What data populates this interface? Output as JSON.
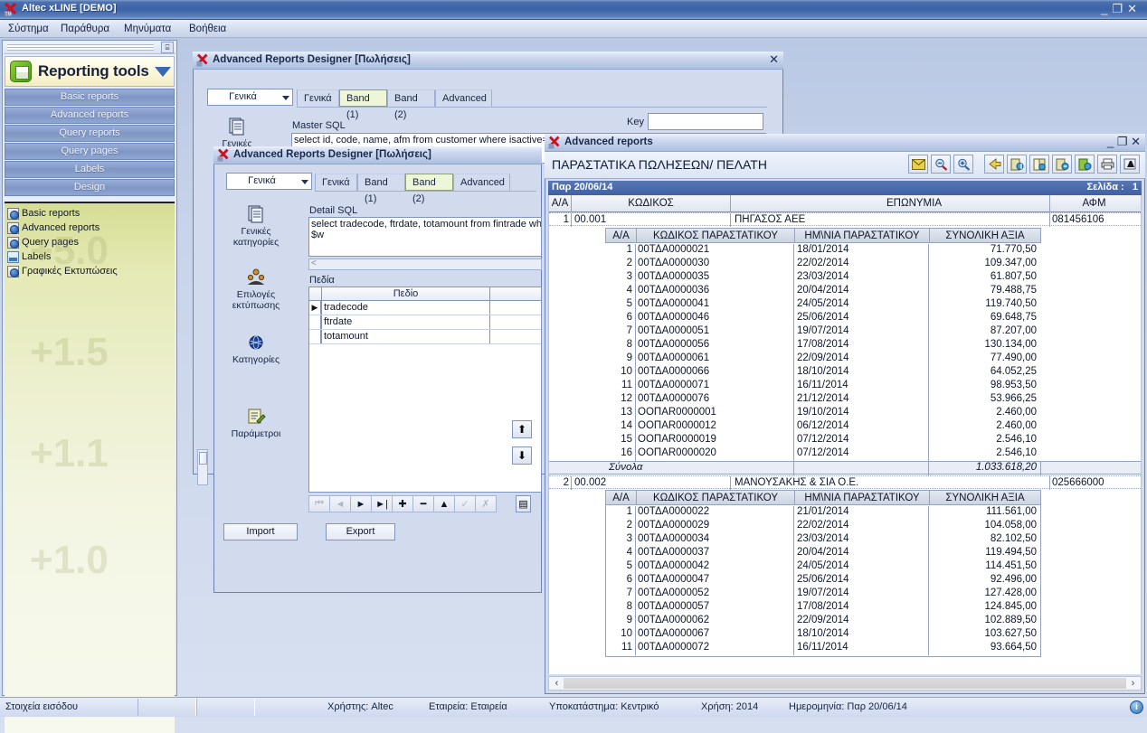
{
  "app": {
    "title": "Altec xLINE [DEMO]",
    "window_buttons": {
      "minimize": "_",
      "restore": "❐",
      "close": "✕"
    },
    "menu": [
      {
        "label": "Σύστημα"
      },
      {
        "label": "Παράθυρα"
      },
      {
        "label": "Μηνύματα"
      },
      {
        "label": "Βοήθεια"
      }
    ]
  },
  "navigator": {
    "pin_icon": "pin-icon",
    "header_title": "Reporting tools",
    "header_icon": "report-book-icon",
    "caret_icon": "chevron-down-icon",
    "buttons": [
      {
        "label": "Basic reports"
      },
      {
        "label": "Advanced reports"
      },
      {
        "label": "Query reports"
      },
      {
        "label": "Query pages"
      },
      {
        "label": "Labels"
      },
      {
        "label": "Design"
      }
    ],
    "items": [
      {
        "label": "Basic reports",
        "icon": "report-globe-icon"
      },
      {
        "label": "Advanced reports",
        "icon": "report-globe-icon"
      },
      {
        "label": "Query pages",
        "icon": "report-globe-icon"
      },
      {
        "label": "Labels",
        "icon": "label-icon"
      },
      {
        "label": "Γραφικές Εκτυπώσεις",
        "icon": "report-globe-icon"
      }
    ],
    "watermarks": [
      "+5.0",
      "+1.5",
      "+1.1",
      "+1.0"
    ]
  },
  "designer_back": {
    "title": "Advanced Reports Designer [Πωλήσεις]",
    "close_label": "✕",
    "category_combo": "Γενικά",
    "tabs": [
      {
        "label": "Γενικά",
        "selected": false
      },
      {
        "label": "Band (1)",
        "selected": true
      },
      {
        "label": "Band (2)",
        "selected": false
      },
      {
        "label": "Advanced",
        "selected": false
      }
    ],
    "side_first": {
      "label": "Γενικές",
      "icon": "document-stack-icon"
    },
    "master_sql_label": "Master SQL",
    "master_sql_value": "select id, code, name, afm from customer where isactive=1",
    "key_label": "Key",
    "key_value": ""
  },
  "designer_front": {
    "title": "Advanced Reports Designer [Πωλήσεις]",
    "category_combo": "Γενικά",
    "tabs": [
      {
        "label": "Γενικά",
        "selected": false
      },
      {
        "label": "Band (1)",
        "selected": false
      },
      {
        "label": "Band (2)",
        "selected": true
      },
      {
        "label": "Advanced",
        "selected": false
      }
    ],
    "side_items": [
      {
        "label": "Γενικές\nκατηγορίες",
        "line1": "Γενικές",
        "line2": "κατηγορίες",
        "icon": "document-stack-icon"
      },
      {
        "label": "Επιλογές\nεκτύπωσης",
        "line1": "Επιλογές",
        "line2": "εκτύπωσης",
        "icon": "people-group-icon"
      },
      {
        "label": "Κατηγορίες",
        "line1": "Κατηγορίες",
        "line2": "",
        "icon": "globe-icon"
      },
      {
        "label": "Παράμετροι",
        "line1": "Παράμετροι",
        "line2": "",
        "icon": "form-edit-icon"
      }
    ],
    "detail_sql_label": "Detail SQL",
    "detail_sql_line1": "select tradecode, ftrdate, totamount from fintrade wher",
    "detail_sql_line2": "$w",
    "fields_label": "Πεδία",
    "fields_column_header": "Πεδίο",
    "fields": [
      {
        "name": "tradecode",
        "selected": true
      },
      {
        "name": "ftrdate",
        "selected": false
      },
      {
        "name": "totamount",
        "selected": false
      }
    ],
    "nav_buttons": [
      {
        "icon": "first-record-icon",
        "label": "⏮",
        "disabled": true
      },
      {
        "icon": "prev-record-icon",
        "label": "◄",
        "disabled": true
      },
      {
        "icon": "next-record-icon",
        "label": "►",
        "disabled": false
      },
      {
        "icon": "last-record-icon",
        "label": "►|",
        "disabled": false
      },
      {
        "icon": "add-record-icon",
        "label": "✚",
        "disabled": false
      },
      {
        "icon": "delete-record-icon",
        "label": "━",
        "disabled": false
      },
      {
        "icon": "edit-record-icon",
        "label": "▲",
        "disabled": false
      },
      {
        "icon": "post-record-icon",
        "label": "✓",
        "disabled": true
      },
      {
        "icon": "cancel-record-icon",
        "label": "✗",
        "disabled": true
      }
    ],
    "grid_menu_icon": "grid-menu-icon",
    "move_up_icon": "move-up-arrow-icon",
    "move_down_icon": "move-down-arrow-icon",
    "import_label": "Import",
    "export_label": "Export"
  },
  "report_viewer": {
    "title": "Advanced reports",
    "window_buttons": {
      "minimize": "_",
      "restore": "❐",
      "close": "✕"
    },
    "report_title": "ΠΑΡΑΣΤΑΤΙΚΑ ΠΩΛΗΣΕΩΝ/ ΠΕΛΑΤΗ",
    "toolbar": [
      {
        "name": "email-report-icon",
        "group": 1
      },
      {
        "name": "zoom-out-icon",
        "group": 1
      },
      {
        "name": "zoom-in-icon",
        "group": 1
      },
      {
        "name": "back-arrow-icon",
        "group": 2
      },
      {
        "name": "first-page-icon",
        "group": 2
      },
      {
        "name": "prev-page-icon",
        "group": 2
      },
      {
        "name": "next-page-icon",
        "group": 2
      },
      {
        "name": "last-page-icon",
        "group": 2
      },
      {
        "name": "print-icon",
        "group": 2
      },
      {
        "name": "exit-icon",
        "group": 2
      }
    ],
    "page_bar": {
      "date": "Παρ 20/06/14",
      "page_label": "Σελίδα :",
      "page_number": "1"
    },
    "master_columns": [
      "A/A",
      "ΚΩΔΙΚΟΣ",
      "ΕΠΩΝΥΜΙΑ",
      "ΑΦΜ"
    ],
    "detail_columns": [
      "A/A",
      "ΚΩΔΙΚΟΣ ΠΑΡΑΣΤΑΤΙΚΟΥ",
      "ΗΜ\\ΝΙΑ ΠΑΡΑΣΤΑΤΙΚΟΥ",
      "ΣΥΝΟΛΙΚΗ ΑΞΙΑ"
    ],
    "totals_label": "Σύνολα",
    "groups": [
      {
        "aa": "1",
        "code": "00.001",
        "name": "ΠΗΓΑΣΟΣ ΑΕΕ",
        "afm": "081456106",
        "total": "1.033.618,20",
        "rows": [
          {
            "aa": "1",
            "doc": "00ΤΔΑ0000021",
            "date": "18/01/2014",
            "amount": "71.770,50"
          },
          {
            "aa": "2",
            "doc": "00ΤΔΑ0000030",
            "date": "22/02/2014",
            "amount": "109.347,00"
          },
          {
            "aa": "3",
            "doc": "00ΤΔΑ0000035",
            "date": "23/03/2014",
            "amount": "61.807,50"
          },
          {
            "aa": "4",
            "doc": "00ΤΔΑ0000036",
            "date": "20/04/2014",
            "amount": "79.488,75"
          },
          {
            "aa": "5",
            "doc": "00ΤΔΑ0000041",
            "date": "24/05/2014",
            "amount": "119.740,50"
          },
          {
            "aa": "6",
            "doc": "00ΤΔΑ0000046",
            "date": "25/06/2014",
            "amount": "69.648,75"
          },
          {
            "aa": "7",
            "doc": "00ΤΔΑ0000051",
            "date": "19/07/2014",
            "amount": "87.207,00"
          },
          {
            "aa": "8",
            "doc": "00ΤΔΑ0000056",
            "date": "17/08/2014",
            "amount": "130.134,00"
          },
          {
            "aa": "9",
            "doc": "00ΤΔΑ0000061",
            "date": "22/09/2014",
            "amount": "77.490,00"
          },
          {
            "aa": "10",
            "doc": "00ΤΔΑ0000066",
            "date": "18/10/2014",
            "amount": "64.052,25"
          },
          {
            "aa": "11",
            "doc": "00ΤΔΑ0000071",
            "date": "16/11/2014",
            "amount": "98.953,50"
          },
          {
            "aa": "12",
            "doc": "00ΤΔΑ0000076",
            "date": "21/12/2014",
            "amount": "53.966,25"
          },
          {
            "aa": "13",
            "doc": "ΟΟΠΑR0000001",
            "date": "19/10/2014",
            "amount": "2.460,00"
          },
          {
            "aa": "14",
            "doc": "ΟΟΠΑR0000012",
            "date": "06/12/2014",
            "amount": "2.460,00"
          },
          {
            "aa": "15",
            "doc": "ΟΟΠΑR0000019",
            "date": "07/12/2014",
            "amount": "2.546,10"
          },
          {
            "aa": "16",
            "doc": "ΟΟΠΑR0000020",
            "date": "07/12/2014",
            "amount": "2.546,10"
          }
        ]
      },
      {
        "aa": "2",
        "code": "00.002",
        "name": "ΜΑΝΟΥΣΑΚΗΣ & ΣΙΑ Ο.Ε.",
        "afm": "025666000",
        "total": "",
        "rows": [
          {
            "aa": "1",
            "doc": "00ΤΔΑ0000022",
            "date": "21/01/2014",
            "amount": "111.561,00"
          },
          {
            "aa": "2",
            "doc": "00ΤΔΑ0000029",
            "date": "22/02/2014",
            "amount": "104.058,00"
          },
          {
            "aa": "3",
            "doc": "00ΤΔΑ0000034",
            "date": "23/03/2014",
            "amount": "82.102,50"
          },
          {
            "aa": "4",
            "doc": "00ΤΔΑ0000037",
            "date": "20/04/2014",
            "amount": "119.494,50"
          },
          {
            "aa": "5",
            "doc": "00ΤΔΑ0000042",
            "date": "24/05/2014",
            "amount": "114.451,50"
          },
          {
            "aa": "6",
            "doc": "00ΤΔΑ0000047",
            "date": "25/06/2014",
            "amount": "92.496,00"
          },
          {
            "aa": "7",
            "doc": "00ΤΔΑ0000052",
            "date": "19/07/2014",
            "amount": "127.428,00"
          },
          {
            "aa": "8",
            "doc": "00ΤΔΑ0000057",
            "date": "17/08/2014",
            "amount": "124.845,00"
          },
          {
            "aa": "9",
            "doc": "00ΤΔΑ0000062",
            "date": "22/09/2014",
            "amount": "102.889,50"
          },
          {
            "aa": "10",
            "doc": "00ΤΔΑ0000067",
            "date": "18/10/2014",
            "amount": "103.627,50"
          },
          {
            "aa": "11",
            "doc": "00ΤΔΑ0000072",
            "date": "16/11/2014",
            "amount": "93.664,50"
          }
        ]
      }
    ],
    "hscroll": {
      "left_arrow": "‹",
      "right_arrow": "›"
    }
  },
  "statusbar": {
    "left_text": "Στοιχεία εισόδου",
    "segments": [
      {
        "label": "Χρήστης: Altec"
      },
      {
        "label": "Εταιρεία: Εταιρεία"
      },
      {
        "label": "Υποκατάστημα: Κεντρικό"
      },
      {
        "label": "Χρήση: 2014"
      },
      {
        "label": "Ημερομηνία: Παρ 20/06/14"
      }
    ],
    "info_icon": "info-icon"
  },
  "colors": {
    "title_blue": "#3c63a6",
    "nav_button": "#7f96c6",
    "nav_list_bg": "#e8eebf",
    "selected_tab": "#eef6d9",
    "report_header_blue": "#4a6bab"
  }
}
